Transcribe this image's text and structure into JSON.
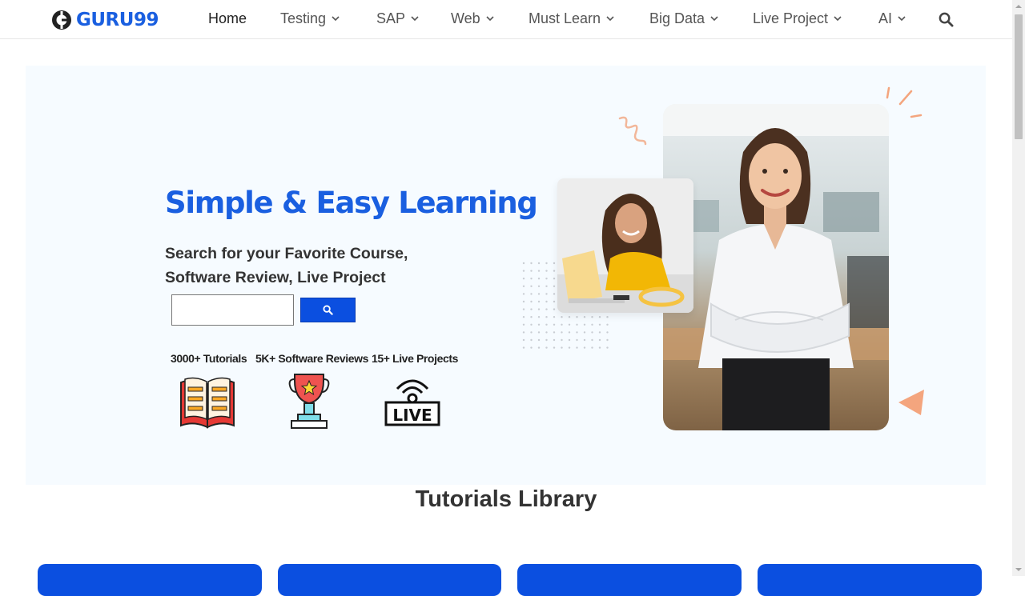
{
  "brand": {
    "name": "GURU99",
    "color": "#1a5fe0"
  },
  "nav": {
    "items": [
      {
        "label": "Home",
        "dropdown": false
      },
      {
        "label": "Testing",
        "dropdown": true
      },
      {
        "label": "SAP",
        "dropdown": true
      },
      {
        "label": "Web",
        "dropdown": true
      },
      {
        "label": "Must Learn",
        "dropdown": true
      },
      {
        "label": "Big Data",
        "dropdown": true
      },
      {
        "label": "Live Project",
        "dropdown": true
      },
      {
        "label": "AI",
        "dropdown": true
      }
    ],
    "search_icon": "search-icon"
  },
  "hero": {
    "title": "Simple & Easy Learning",
    "subtitle": "Search for your Favorite Course, Software Review, Live Project",
    "search": {
      "value": "",
      "button_icon": "search-icon"
    },
    "stats": [
      {
        "label": "3000+ Tutorials",
        "icon": "book-icon"
      },
      {
        "label": "5K+ Software Reviews",
        "icon": "trophy-icon"
      },
      {
        "label": "15+ Live Projects",
        "icon": "live-broadcast-icon"
      }
    ],
    "accent_color": "#0b4fe0",
    "background": "#f6fbff"
  },
  "library": {
    "title": "Tutorials Library"
  }
}
